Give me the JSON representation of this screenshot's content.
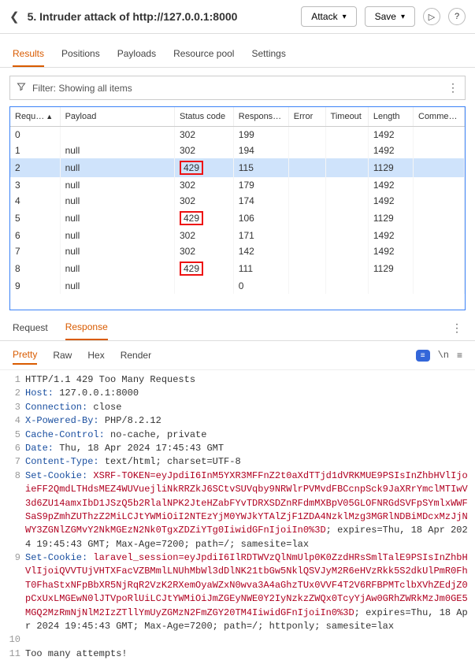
{
  "header": {
    "title": "5. Intruder attack of http://127.0.0.1:8000",
    "attack_btn": "Attack",
    "save_btn": "Save"
  },
  "tabs": {
    "results": "Results",
    "positions": "Positions",
    "payloads": "Payloads",
    "resource": "Resource pool",
    "settings": "Settings"
  },
  "filter": {
    "label": "Filter: Showing all items"
  },
  "columns": {
    "request": "Requ…",
    "payload": "Payload",
    "status": "Status code",
    "response": "Respons…",
    "error": "Error",
    "timeout": "Timeout",
    "length": "Length",
    "comment": "Comme…"
  },
  "rows": [
    {
      "req": "0",
      "payload": "",
      "status": "302",
      "resp": "199",
      "len": "1492",
      "hi": false,
      "sel": false
    },
    {
      "req": "1",
      "payload": "null",
      "status": "302",
      "resp": "194",
      "len": "1492",
      "hi": false,
      "sel": false
    },
    {
      "req": "2",
      "payload": "null",
      "status": "429",
      "resp": "115",
      "len": "1129",
      "hi": true,
      "sel": true
    },
    {
      "req": "3",
      "payload": "null",
      "status": "302",
      "resp": "179",
      "len": "1492",
      "hi": false,
      "sel": false
    },
    {
      "req": "4",
      "payload": "null",
      "status": "302",
      "resp": "174",
      "len": "1492",
      "hi": false,
      "sel": false
    },
    {
      "req": "5",
      "payload": "null",
      "status": "429",
      "resp": "106",
      "len": "1129",
      "hi": true,
      "sel": false
    },
    {
      "req": "6",
      "payload": "null",
      "status": "302",
      "resp": "171",
      "len": "1492",
      "hi": false,
      "sel": false
    },
    {
      "req": "7",
      "payload": "null",
      "status": "302",
      "resp": "142",
      "len": "1492",
      "hi": false,
      "sel": false
    },
    {
      "req": "8",
      "payload": "null",
      "status": "429",
      "resp": "111",
      "len": "1129",
      "hi": true,
      "sel": false
    },
    {
      "req": "9",
      "payload": "null",
      "status": "",
      "resp": "0",
      "len": "",
      "hi": false,
      "sel": false
    }
  ],
  "subtabs": {
    "request": "Request",
    "response": "Response"
  },
  "viewtabs": {
    "pretty": "Pretty",
    "raw": "Raw",
    "hex": "Hex",
    "render": "Render"
  },
  "chip": "≡",
  "newline_icon": "\\n",
  "hamburger": "≡",
  "resp_lines": [
    {
      "n": "1",
      "parts": [
        {
          "t": "HTTP/1.1 429 Too Many Requests",
          "c": ""
        }
      ]
    },
    {
      "n": "2",
      "parts": [
        {
          "t": "Host:",
          "c": "hdrkey"
        },
        {
          "t": " 127.0.0.1:8000",
          "c": ""
        }
      ]
    },
    {
      "n": "3",
      "parts": [
        {
          "t": "Connection:",
          "c": "hdrkey"
        },
        {
          "t": " close",
          "c": ""
        }
      ]
    },
    {
      "n": "4",
      "parts": [
        {
          "t": "X-Powered-By:",
          "c": "hdrkey"
        },
        {
          "t": " PHP/8.2.12",
          "c": ""
        }
      ]
    },
    {
      "n": "5",
      "parts": [
        {
          "t": "Cache-Control:",
          "c": "hdrkey"
        },
        {
          "t": " no-cache, private",
          "c": ""
        }
      ]
    },
    {
      "n": "6",
      "parts": [
        {
          "t": "Date:",
          "c": "hdrkey"
        },
        {
          "t": " Thu, 18 Apr 2024 17:45:43 GMT",
          "c": ""
        }
      ]
    },
    {
      "n": "7",
      "parts": [
        {
          "t": "Content-Type:",
          "c": "hdrkey"
        },
        {
          "t": " text/html; charset=UTF-8",
          "c": ""
        }
      ]
    },
    {
      "n": "8",
      "parts": [
        {
          "t": "Set-Cookie:",
          "c": "hdrkey"
        },
        {
          "t": " XSRF-TOKEN=",
          "c": "red"
        },
        {
          "t": "eyJpdiI6InM5YXR3MFFnZ2t0aXdTTjd1dVRKMUE9PSIsInZhbHVlIjoieFF2QmdLTHdsMEZ4WUVuejliNkRRZkJ6SCtvSUVqby9NRWlrPVMvdFBCcnpSck9JaXRrYmclMTIwV3d6ZU14amxIbD1JSzQ5b2RlalNPK2JteHZabFYvTDRXSDZnRFdmMXBpV05GLOFNRGdSVFpSYmlxWWFSaS9pZmhZUThzZ2MiLCJtYWMiOiI2NTEzYjM0YWJkYTAlZjF1ZDA4NzklMzg3MGRlNDBiMDcxMzJjNWY3ZGNlZGMvY2NkMGEzN2Nk0TgxZDZiYTg0IiwidGFnIjoiIn0%3D",
          "c": "red"
        },
        {
          "t": "; expires=Thu, 18 Apr 2024 19:45:43 GMT; Max-Age=7200; path=/; samesite=lax",
          "c": ""
        }
      ]
    },
    {
      "n": "9",
      "parts": [
        {
          "t": "Set-Cookie:",
          "c": "hdrkey"
        },
        {
          "t": " laravel_session=",
          "c": "red"
        },
        {
          "t": "eyJpdiI6IlRDTWVzQlNmUlp0K0ZzdHRsSmlTalE9PSIsInZhbHVlIjoiQVVTUjVHTXFacVZBMmlLNUhMbWl3dDlNK21tbGw5NklQSVJyM2R6eHVzRkk5S2dkUlPmR0FhT0FhaStxNFpBbXR5NjRqR2VzK2RXemOyaWZxN0wva3A4aGhzTUx0VVF4T2V6RFBPMTclbXVhZEdjZ0pCxUxLMGEwN0lJTVpoRlUiLCJtYWMiOiJmZGEyNWE0Y2IyNzkzZWQx0TcyYjAw0GRhZWRkMzJm0GE5MGQ2MzRmNjNlM2IzZTllYmUyZGMzN2FmZGY20TM4IiwidGFnIjoiIn0%3D",
          "c": "red"
        },
        {
          "t": "; expires=Thu, 18 Apr 2024 19:45:43 GMT; Max-Age=7200; path=/; httponly; samesite=lax",
          "c": ""
        }
      ]
    },
    {
      "n": "10",
      "parts": [
        {
          "t": "",
          "c": ""
        }
      ]
    },
    {
      "n": "11",
      "parts": [
        {
          "t": "Too many attempts!",
          "c": ""
        }
      ]
    }
  ]
}
